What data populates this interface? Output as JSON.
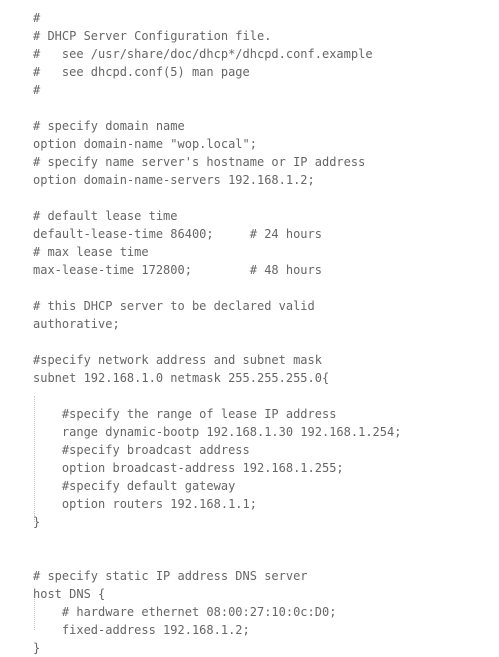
{
  "lines": [
    "#",
    "# DHCP Server Configuration file.",
    "#   see /usr/share/doc/dhcp*/dhcpd.conf.example",
    "#   see dhcpd.conf(5) man page",
    "#",
    "",
    "# specify domain name",
    "option domain-name \"wop.local\";",
    "# specify name server's hostname or IP address",
    "option domain-name-servers 192.168.1.2;",
    "",
    "# default lease time",
    "default-lease-time 86400;     # 24 hours",
    "# max lease time",
    "max-lease-time 172800;        # 48 hours",
    "",
    "# this DHCP server to be declared valid",
    "authorative;",
    "",
    "#specify network address and subnet mask",
    "subnet 192.168.1.0 netmask 255.255.255.0{",
    "",
    "    #specify the range of lease IP address",
    "    range dynamic-bootp 192.168.1.30 192.168.1.254;",
    "    #specify broadcast address",
    "    option broadcast-address 192.168.1.255;",
    "    #specify default gateway",
    "    option routers 192.168.1.1;",
    "}",
    "",
    "",
    "# specify static IP address DNS server",
    "host DNS {",
    "    # hardware ethernet 08:00:27:10:0c:D0;",
    "    fixed-address 192.168.1.2;",
    "}"
  ]
}
